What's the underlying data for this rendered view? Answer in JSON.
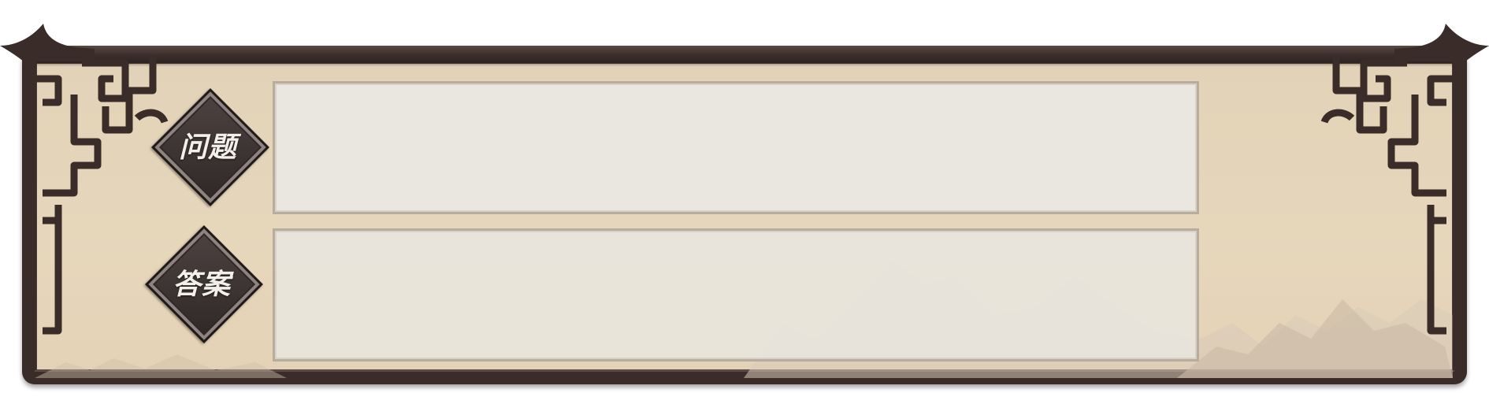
{
  "question": {
    "label": "问题",
    "value": ""
  },
  "answer": {
    "label": "答案",
    "value": ""
  },
  "colors": {
    "frame_dark": "#3a2c29",
    "panel_bg": "#e4d3b8",
    "field_bg": "#e9e7e1",
    "badge_bg": "#3c3433",
    "badge_text": "#f3efea"
  }
}
